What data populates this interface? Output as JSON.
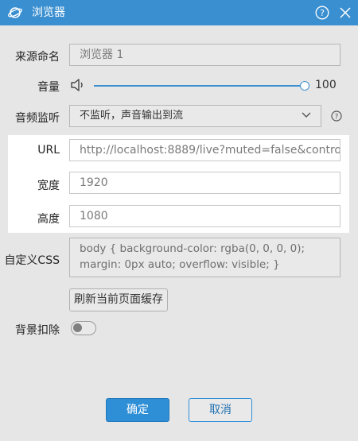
{
  "window": {
    "title": "浏览器",
    "icon": "planet-icon",
    "help_icon": "help-icon",
    "close_icon": "close-icon",
    "accent": "#3a8fd0"
  },
  "form": {
    "source_name": {
      "label": "来源命名",
      "value": "浏览器 1"
    },
    "volume": {
      "label": "音量",
      "value": "100",
      "level": 1.0,
      "icon": "speaker-icon"
    },
    "audio_monitor": {
      "label": "音频监听",
      "value": "不监听，声音输出到流",
      "info_icon": "info-icon"
    },
    "url": {
      "label": "URL",
      "value": "http://localhost:8889/live?muted=false&contro"
    },
    "width": {
      "label": "宽度",
      "value": "1920"
    },
    "height": {
      "label": "高度",
      "value": "1080"
    },
    "custom_css": {
      "label": "自定义CSS",
      "lines": [
        "body { background-color: rgba(0, 0, 0, 0);",
        "margin: 0px auto; overflow: visible; }"
      ]
    },
    "refresh_cache_label": "刷新当前页面缓存",
    "background_removal": {
      "label": "背景扣除",
      "enabled": false
    }
  },
  "footer": {
    "ok_label": "确定",
    "cancel_label": "取消"
  }
}
